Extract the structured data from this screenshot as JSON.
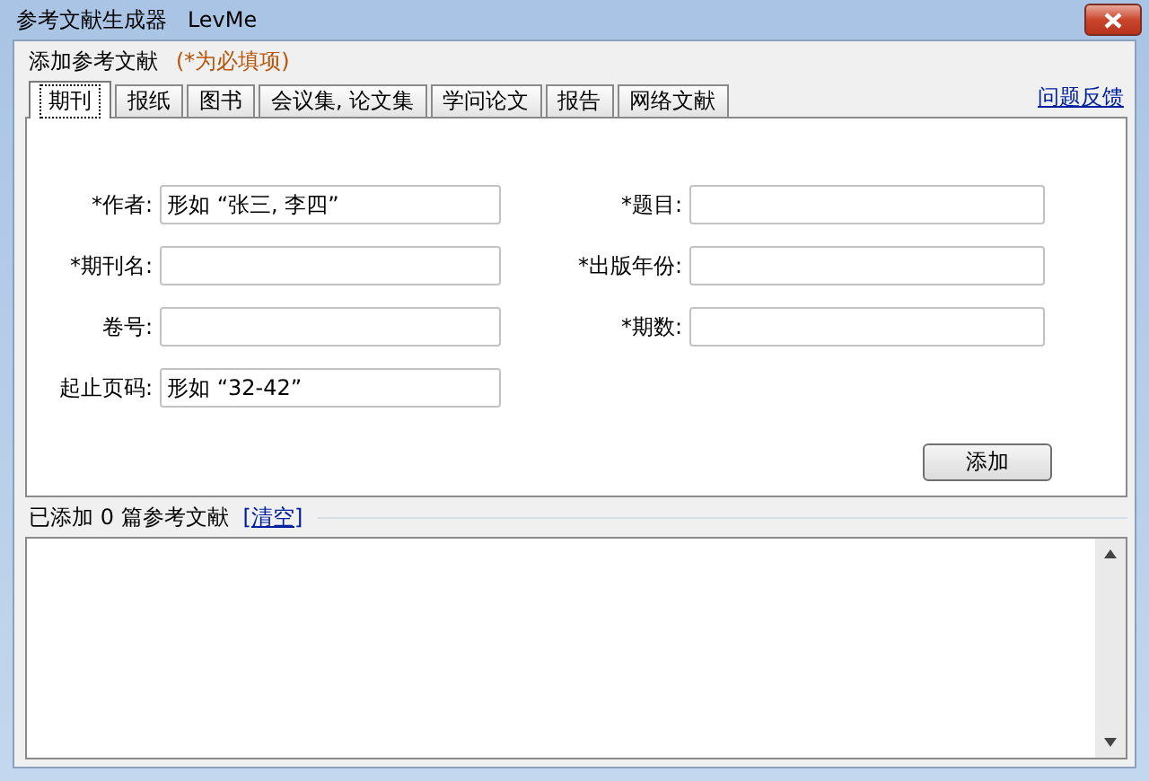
{
  "window": {
    "title": "参考文献生成器   LevMe"
  },
  "group": {
    "title": "添加参考文献",
    "hint": "(*为必填项)"
  },
  "tabs": [
    {
      "label": "期刊",
      "selected": true
    },
    {
      "label": "报纸",
      "selected": false
    },
    {
      "label": "图书",
      "selected": false
    },
    {
      "label": "会议集, 论文集",
      "selected": false
    },
    {
      "label": "学问论文",
      "selected": false
    },
    {
      "label": "报告",
      "selected": false
    },
    {
      "label": "网络文献",
      "selected": false
    }
  ],
  "feedback_link": "问题反馈",
  "fields": [
    {
      "label": "*作者:",
      "value": "形如 “张三, 李四”"
    },
    {
      "label": "*题目:"
    },
    {
      "label": "*期刊名:"
    },
    {
      "label": "*出版年份:"
    },
    {
      "label": "卷号:"
    },
    {
      "label": "*期数:"
    },
    {
      "label": "起止页码:",
      "value": "形如 “32-42”"
    }
  ],
  "add_button": "添加",
  "status": {
    "text": "已添加 0 篇参考文献",
    "clear_link": "[清空]"
  }
}
